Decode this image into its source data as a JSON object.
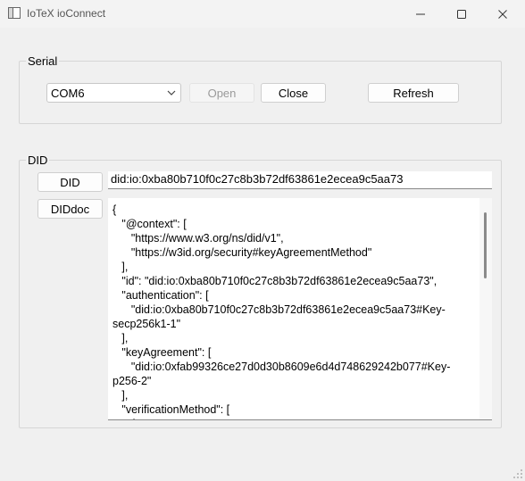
{
  "window": {
    "title": "IoTeX ioConnect"
  },
  "serial": {
    "group_title": "Serial",
    "port_selected": "COM6",
    "open_label": "Open",
    "close_label": "Close",
    "refresh_label": "Refresh"
  },
  "did": {
    "group_title": "DID",
    "did_button_label": "DID",
    "diddoc_button_label": "DIDdoc",
    "did_value": "did:io:0xba80b710f0c27c8b3b72df63861e2ecea9c5aa73",
    "doc_lines": [
      "{",
      "   \"@context\": [",
      "      \"https://www.w3.org/ns/did/v1\",",
      "      \"https://w3id.org/security#keyAgreementMethod\"",
      "   ],",
      "   \"id\": \"did:io:0xba80b710f0c27c8b3b72df63861e2ecea9c5aa73\",",
      "   \"authentication\": [",
      "      \"did:io:0xba80b710f0c27c8b3b72df63861e2ecea9c5aa73#Key-",
      "secp256k1-1\"",
      "   ],",
      "   \"keyAgreement\": [",
      "      \"did:io:0xfab99326ce27d0d30b8609e6d4d748629242b077#Key-",
      "p256-2\"",
      "   ],",
      "   \"verificationMethod\": [",
      "      {"
    ]
  }
}
